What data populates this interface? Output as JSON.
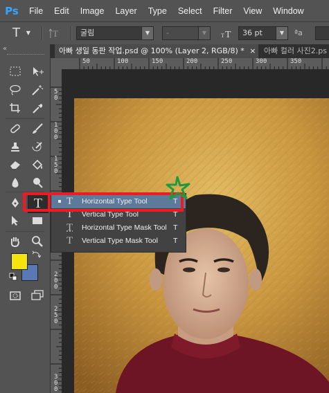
{
  "app": {
    "logo": "Ps"
  },
  "menu": [
    "File",
    "Edit",
    "Image",
    "Layer",
    "Type",
    "Select",
    "Filter",
    "View",
    "Window"
  ],
  "options_bar": {
    "tool_glyph": "T",
    "font_family": "굴림",
    "font_style": "-",
    "font_size": "36 pt",
    "aa_glyph": "ªa"
  },
  "tabs": [
    {
      "label": "아빠 생일 동판 작업.psd @ 100% (Layer 2, RGB/8) *",
      "close": "×"
    },
    {
      "label": "아빠 컬러 사진2.ps"
    }
  ],
  "ruler_h": [
    "50",
    "100",
    "150",
    "200",
    "250",
    "300",
    "350"
  ],
  "ruler_v": [
    "5",
    "0",
    "1",
    "0",
    "0",
    "1",
    "5",
    "0",
    "2",
    "0",
    "0",
    "2",
    "5",
    "0",
    "3",
    "0",
    "0"
  ],
  "toolbar": {
    "collapse": "«"
  },
  "flyout": [
    {
      "icon": "T",
      "label": "Horizontal Type Tool",
      "key": "T",
      "selected": true
    },
    {
      "icon": "T",
      "label": "Vertical Type Tool",
      "key": "T",
      "selected": false
    },
    {
      "icon": "T",
      "label": "Horizontal Type Mask Tool",
      "key": "T",
      "selected": false
    },
    {
      "icon": "T",
      "label": "Vertical Type Mask Tool",
      "key": "T",
      "selected": false
    }
  ],
  "colors": {
    "foreground": "#f5e30c",
    "background": "#5b78b6",
    "highlight_box": "#ee1b24",
    "annotation_star": "#1e9a3c"
  }
}
